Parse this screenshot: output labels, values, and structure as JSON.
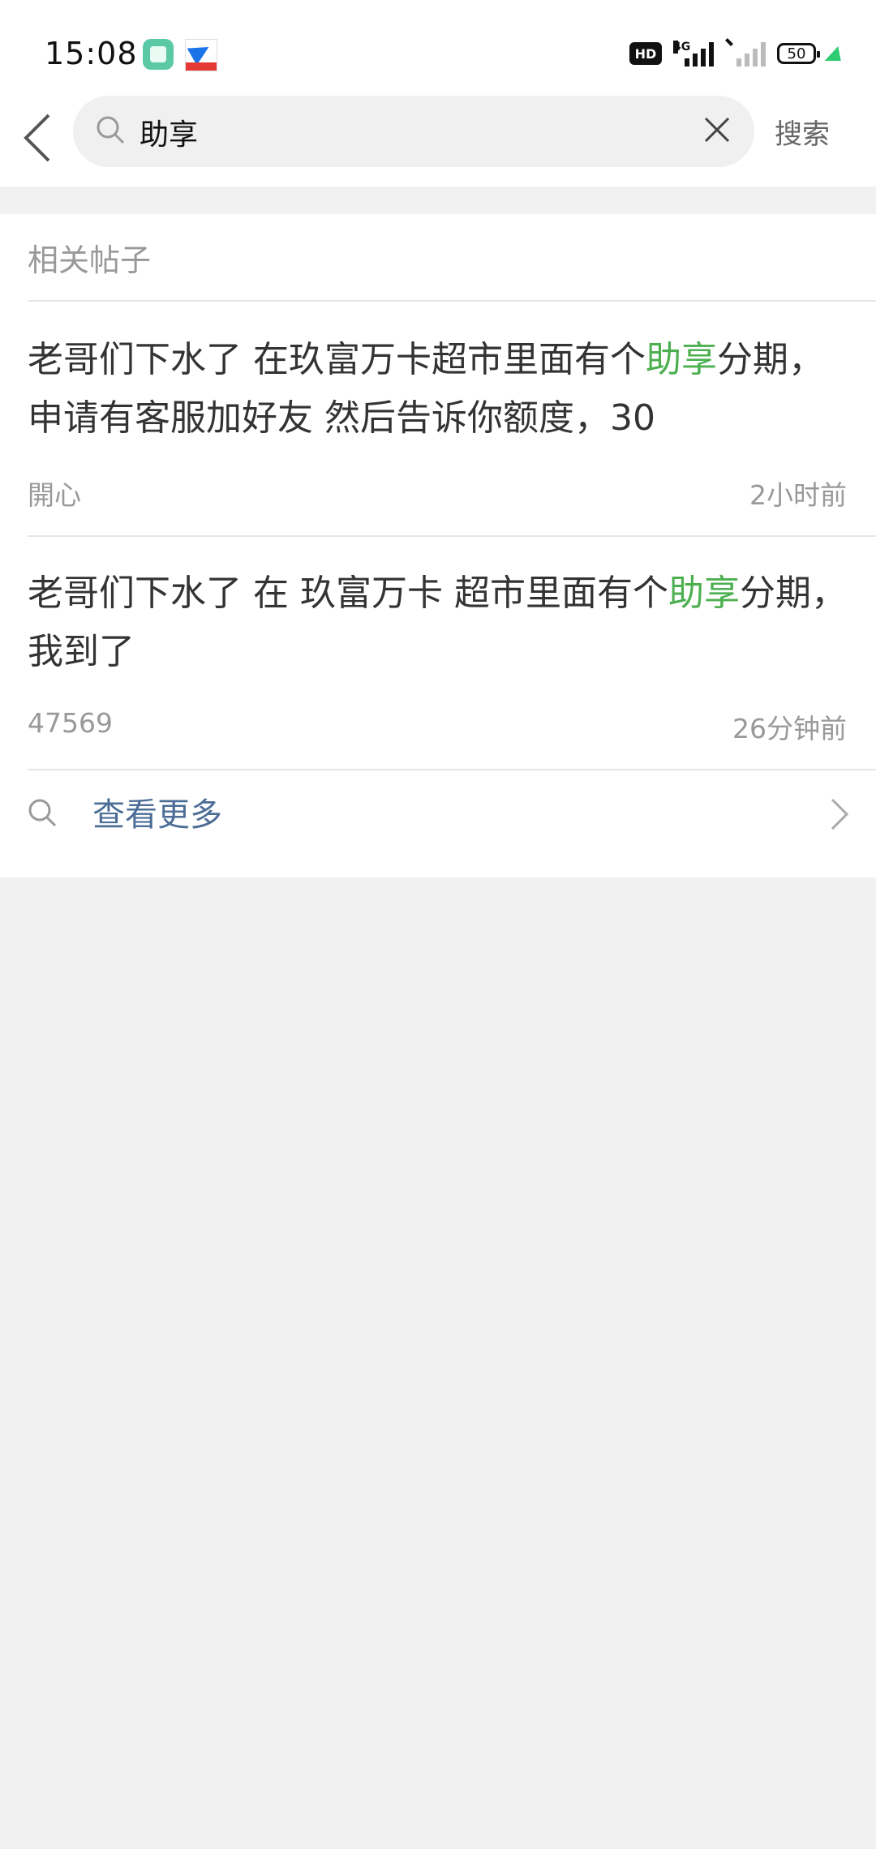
{
  "status_bar": {
    "time": "15:08",
    "network_badge": "HD",
    "network_type": "4G",
    "battery_level": "50",
    "icons": [
      "app-icon-green",
      "app-icon-paper-plane",
      "hd-icon",
      "signal-icon",
      "signal-off-icon",
      "battery-icon",
      "charging-icon"
    ]
  },
  "search": {
    "query": "助享",
    "search_button": "搜索"
  },
  "section": {
    "title": "相关帖子"
  },
  "posts": [
    {
      "text_before": "老哥们下水了 在玖富万卡超市里面有个",
      "highlight": "助享",
      "text_after": "分期，申请有客服加好友 然后告诉你额度，30",
      "author": "開心",
      "time": "2小时前"
    },
    {
      "text_before": "老哥们下水了 在 玖富万卡 超市里面有个",
      "highlight": "助享",
      "text_after": "分期，我到了",
      "author": "47569",
      "time": "26分钟前"
    }
  ],
  "more": {
    "label": "查看更多"
  },
  "colors": {
    "highlight": "#4caf50",
    "link": "#4c6d96",
    "background": "#f1f1f1"
  }
}
